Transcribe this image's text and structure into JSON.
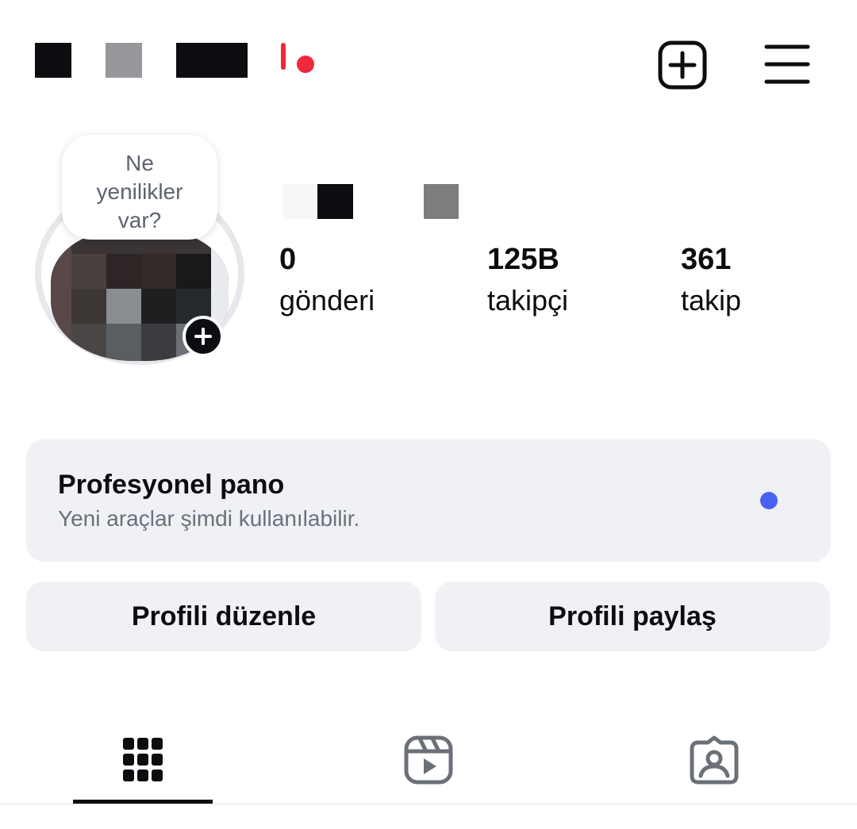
{
  "colors": {
    "text": "#0c0d10",
    "secondary_text": "#6a707c",
    "card_bg": "#f0f1f4",
    "notification_red": "#f0283c",
    "accent_blue": "#4a62f2",
    "icon_gray": "#6b7078"
  },
  "header": {
    "username_redacted": true,
    "new_post_icon": "plus-square-icon",
    "menu_icon": "hamburger-menu-icon"
  },
  "profile": {
    "note_text": "Ne yenilikler var?",
    "avatar_icon": "add-story-plus-icon",
    "name_redacted": true
  },
  "stats": [
    {
      "value": "0",
      "label": "gönderi"
    },
    {
      "value": "125B",
      "label": "takipçi"
    },
    {
      "value": "361",
      "label": "takip"
    }
  ],
  "professional_dashboard": {
    "title": "Profesyonel pano",
    "subtitle": "Yeni araçlar şimdi kullanılabilir."
  },
  "buttons": {
    "edit_profile": "Profili düzenle",
    "share_profile": "Profili paylaş"
  },
  "tabs": [
    {
      "icon": "grid-icon",
      "active": true
    },
    {
      "icon": "reels-icon",
      "active": false
    },
    {
      "icon": "tagged-icon",
      "active": false
    }
  ]
}
